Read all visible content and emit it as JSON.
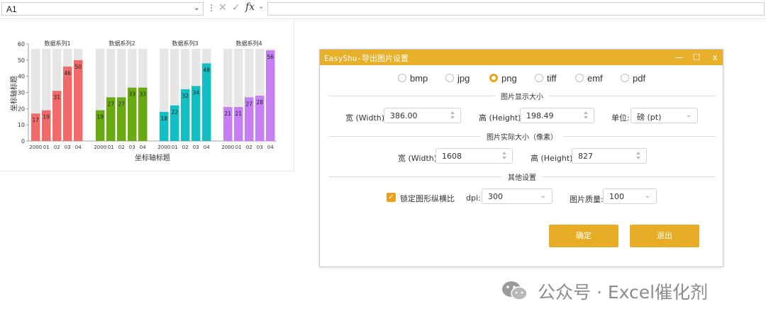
{
  "formula_bar": {
    "cell_ref": "A1",
    "fx_label": "fx",
    "content": ""
  },
  "chart": {
    "panels": [
      "数据系列1",
      "数据系列2",
      "数据系列3",
      "数据系列4"
    ],
    "y_axis_title": "坐标轴标题",
    "x_axis_title": "坐标轴标题",
    "y_ticks": [
      "60",
      "50",
      "40",
      "30",
      "20",
      "10",
      "0"
    ]
  },
  "chart_data": {
    "type": "bar",
    "categories": [
      "2000",
      "01",
      "02",
      "03",
      "04"
    ],
    "ylim": [
      0,
      60
    ],
    "background_value": 57,
    "series": [
      {
        "name": "数据系列1",
        "color": "#f06a6a",
        "values": [
          17,
          19,
          31,
          46,
          50
        ]
      },
      {
        "name": "数据系列2",
        "color": "#6aaa11",
        "values": [
          19,
          27,
          27,
          33,
          33
        ]
      },
      {
        "name": "数据系列3",
        "color": "#11bfc5",
        "values": [
          18,
          22,
          32,
          34,
          48
        ]
      },
      {
        "name": "数据系列4",
        "color": "#c67ef2",
        "values": [
          21,
          21,
          27,
          28,
          56
        ]
      }
    ],
    "background_color": "#e6e6e6",
    "grid": false,
    "xlabel": "坐标轴标题",
    "ylabel": "坐标轴标题"
  },
  "dialog": {
    "title": "EasyShu-导出图片设置",
    "minimize": "—",
    "maximize": "☐",
    "close": "x",
    "formats": [
      "bmp",
      "jpg",
      "png",
      "tiff",
      "emf",
      "pdf"
    ],
    "selected_format": "png",
    "section_display": "图片显示大小",
    "width_label": "宽 (Width):",
    "width_value": "386.00",
    "height_label": "高 (Height):",
    "height_value": "198.49",
    "unit_label": "单位:",
    "unit_value": "磅 (pt)",
    "section_actual": "图片实际大小（像素）",
    "px_width_label": "宽 (Width):",
    "px_width_value": "1608",
    "px_height_label": "高 (Height):",
    "px_height_value": "827",
    "section_other": "其他设置",
    "lock_ratio_label": "锁定图形纵横比",
    "lock_ratio_checked": true,
    "dpi_label": "dpi:",
    "dpi_value": "300",
    "quality_label": "图片质量:",
    "quality_value": "100",
    "ok_label": "确定",
    "cancel_label": "退出",
    "accent_color": "#e8ad27"
  },
  "watermark": {
    "text": "公众号 · Excel催化剂",
    "icon": "wechat-icon"
  }
}
